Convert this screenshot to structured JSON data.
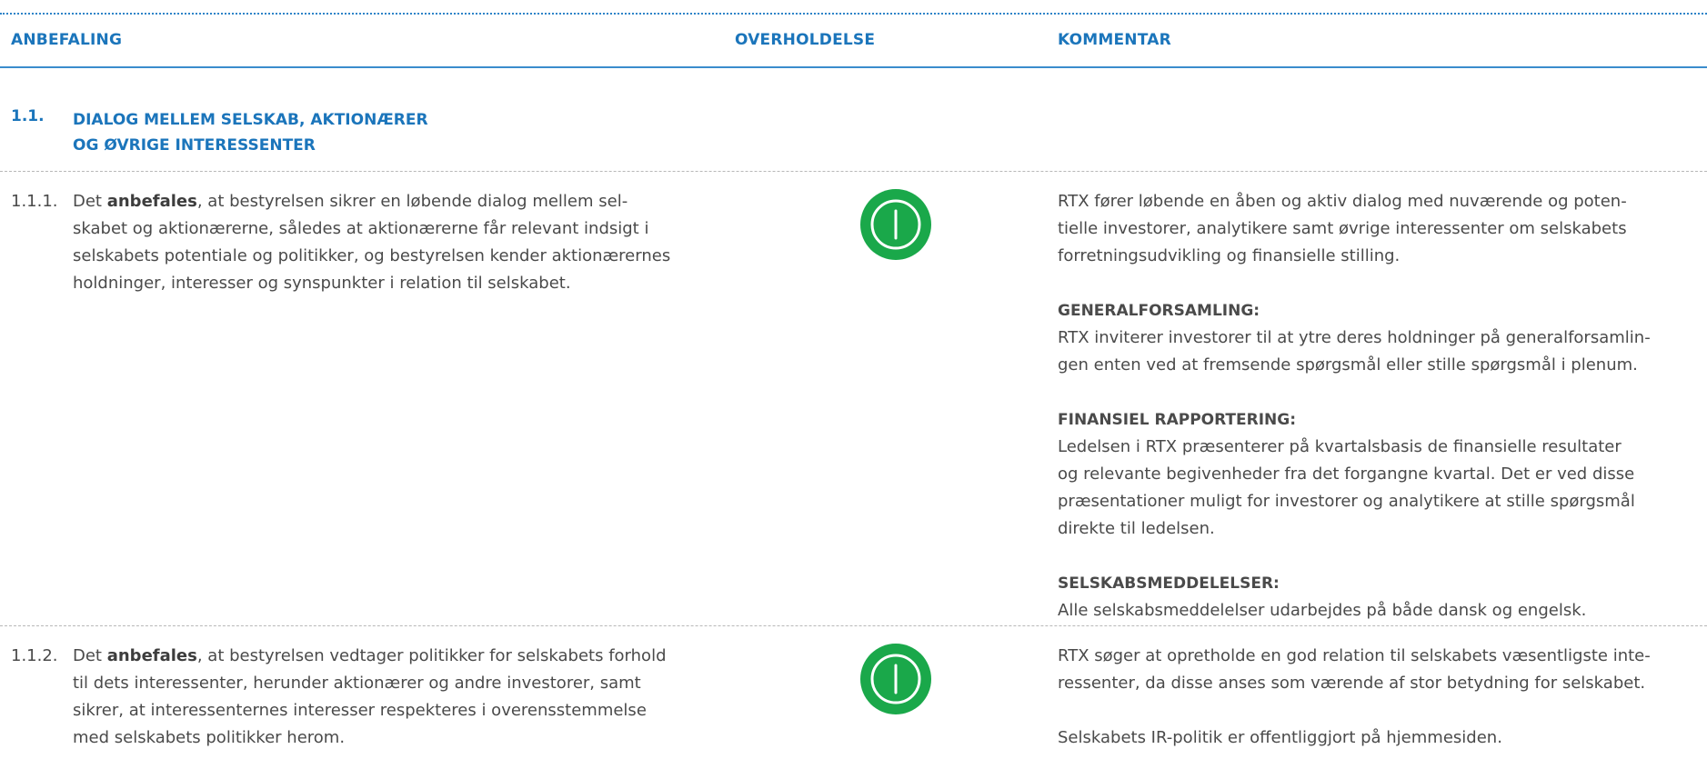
{
  "header": {
    "col_recommendation": "ANBEFALING",
    "col_compliance": "OVERHOLDELSE",
    "col_comment": "KOMMENTAR"
  },
  "section": {
    "number": "1.1.",
    "title_line1": "DIALOG MELLEM SELSKAB, AKTIONÆRER",
    "title_line2": "OG ØVRIGE INTERESSENTER"
  },
  "items": [
    {
      "number": "1.1.1.",
      "text_prefix": "Det ",
      "text_bold": "anbefales",
      "text_lines": [
        ", at bestyrelsen sikrer en løbende dialog mellem sel-",
        "skabet og aktionærerne, således at aktionærerne får relevant indsigt i",
        "selskabets potentiale og politikker, og bestyrelsen kender aktionærernes",
        "holdninger, interesser og synspunkter i relation til selskabet."
      ],
      "compliance_icon": "compliance-check-icon",
      "compliance_color": "#1aa84a",
      "comment": {
        "intro_lines": [
          "RTX fører løbende en åben og aktiv dialog med nuværende og poten-",
          "tielle investorer, analytikere samt øvrige interessenter om selskabets",
          "forretningsudvikling og finansielle stilling."
        ],
        "sections": [
          {
            "heading": "GENERALFORSAMLING:",
            "lines": [
              "RTX inviterer investorer til at ytre deres holdninger på generalforsamlin-",
              "gen enten ved at fremsende spørgsmål eller stille spørgsmål i plenum."
            ]
          },
          {
            "heading": "FINANSIEL RAPPORTERING:",
            "lines": [
              "Ledelsen i RTX præsenterer på kvartalsbasis de finansielle resultater",
              "og relevante begivenheder fra det forgangne kvartal. Det er ved disse",
              "præsentationer muligt for investorer og analytikere at stille spørgsmål",
              "direkte til ledelsen."
            ]
          },
          {
            "heading": "SELSKABSMEDDELELSER:",
            "lines": [
              "Alle selskabsmeddelelser udarbejdes på både dansk og engelsk."
            ]
          }
        ]
      }
    },
    {
      "number": "1.1.2.",
      "text_prefix": "Det ",
      "text_bold": "anbefales",
      "text_lines": [
        ", at bestyrelsen vedtager politikker for selskabets forhold",
        "til dets interessenter, herunder aktionærer og andre investorer, samt",
        "sikrer, at interessenternes interesser respekteres i overensstemmelse",
        "med selskabets politikker herom."
      ],
      "compliance_icon": "compliance-check-icon",
      "compliance_color": "#1aa84a",
      "comment": {
        "line1": "RTX søger at opretholde en god relation til selskabets væsentligste inte-",
        "line2": "ressenter, da disse anses som værende af stor betydning for selskabet.",
        "line3": "Selskabets IR-politik er offentliggjort på hjemmesiden."
      }
    }
  ]
}
